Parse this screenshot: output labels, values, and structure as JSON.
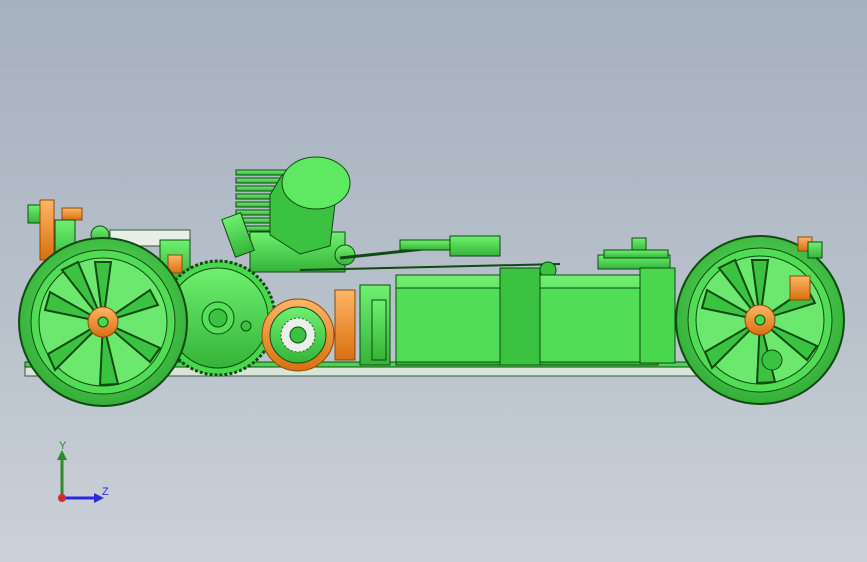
{
  "viewport": {
    "background_top": "#a6b1be",
    "background_bottom": "#cbd1d8"
  },
  "model": {
    "name": "rc-car-chassis",
    "part_color": "#45d64b",
    "edge_color": "#0f4a12",
    "accent_color": "#f08a1c"
  },
  "triad": {
    "y_label": "Y",
    "z_label": "Z",
    "y_color": "#2e8b2e",
    "z_color": "#2b2bd6",
    "x_color": "#d62b2b"
  }
}
